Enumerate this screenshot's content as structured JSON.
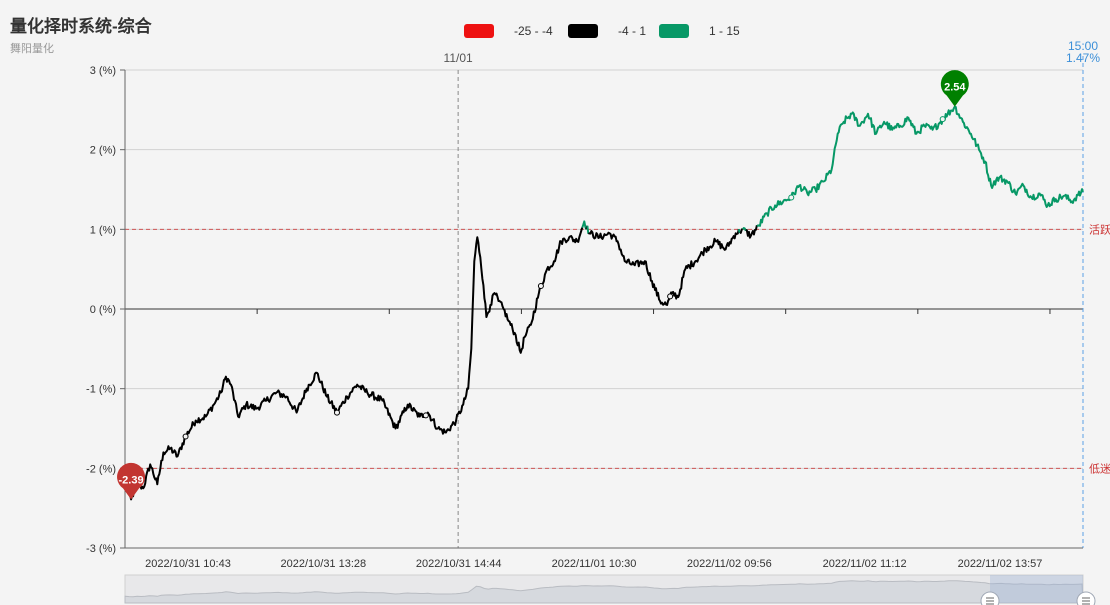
{
  "header": {
    "title": "量化择时系统-综合",
    "subtitle": "舞阳量化"
  },
  "legend": [
    {
      "label": "-25 - -4",
      "color": "#ee1111"
    },
    {
      "label": "-4 - 1",
      "color": "#000000"
    },
    {
      "label": "1 - 15",
      "color": "#079866"
    }
  ],
  "chart_data": {
    "type": "line",
    "y_tick_labels": [
      "3 (%)",
      "2 (%)",
      "1 (%)",
      "0 (%)",
      "-1 (%)",
      "-2 (%)",
      "-3 (%)"
    ],
    "x_tick_labels": [
      "2022/10/31 10:43",
      "2022/10/31 13:28",
      "2022/10/31 14:44",
      "2022/11/01 10:30",
      "2022/11/02 09:56",
      "2022/11/02 11:12",
      "2022/11/02 13:57"
    ],
    "ylim": [
      -3,
      3
    ],
    "grid": true,
    "legend_position": "top-center",
    "reference_lines": [
      {
        "value": 1,
        "label": "活跃"
      },
      {
        "value": -2,
        "label": "低迷"
      }
    ],
    "day_marker": {
      "index": 330,
      "label": "11/01"
    },
    "end_marker": {
      "time": "15:00",
      "value": "1.47%"
    },
    "max_point": {
      "index": 822,
      "value": 2.54,
      "label": "2.54"
    },
    "min_point": {
      "index": 6,
      "value": -2.39,
      "label": "-2.39"
    },
    "piece_colors": {
      "low": "#ee1111",
      "mid": "#000000",
      "high": "#079866"
    },
    "piece_thresholds": [
      -4,
      1,
      15
    ],
    "n_points": 950,
    "keyframes": [
      [
        0,
        -2.15
      ],
      [
        6,
        -2.39
      ],
      [
        12,
        -2.18
      ],
      [
        18,
        -2.25
      ],
      [
        25,
        -1.95
      ],
      [
        32,
        -2.2
      ],
      [
        38,
        -1.8
      ],
      [
        45,
        -1.75
      ],
      [
        52,
        -1.85
      ],
      [
        60,
        -1.6
      ],
      [
        70,
        -1.4
      ],
      [
        80,
        -1.35
      ],
      [
        88,
        -1.2
      ],
      [
        95,
        -1.05
      ],
      [
        100,
        -0.85
      ],
      [
        105,
        -0.95
      ],
      [
        112,
        -1.35
      ],
      [
        120,
        -1.2
      ],
      [
        130,
        -1.25
      ],
      [
        140,
        -1.15
      ],
      [
        150,
        -1.05
      ],
      [
        160,
        -1.1
      ],
      [
        170,
        -1.3
      ],
      [
        180,
        -1.0
      ],
      [
        190,
        -0.8
      ],
      [
        200,
        -1.1
      ],
      [
        210,
        -1.3
      ],
      [
        220,
        -1.1
      ],
      [
        230,
        -0.95
      ],
      [
        240,
        -1.05
      ],
      [
        255,
        -1.15
      ],
      [
        268,
        -1.5
      ],
      [
        280,
        -1.2
      ],
      [
        292,
        -1.35
      ],
      [
        300,
        -1.3
      ],
      [
        310,
        -1.5
      ],
      [
        318,
        -1.55
      ],
      [
        328,
        -1.4
      ],
      [
        335,
        -1.2
      ],
      [
        340,
        -1.0
      ],
      [
        343,
        -0.5
      ],
      [
        346,
        0.6
      ],
      [
        349,
        0.9
      ],
      [
        352,
        0.65
      ],
      [
        355,
        0.3
      ],
      [
        358,
        -0.1
      ],
      [
        362,
        0.05
      ],
      [
        366,
        0.2
      ],
      [
        370,
        0.1
      ],
      [
        375,
        0.0
      ],
      [
        380,
        -0.15
      ],
      [
        386,
        -0.3
      ],
      [
        392,
        -0.55
      ],
      [
        396,
        -0.35
      ],
      [
        402,
        -0.2
      ],
      [
        410,
        0.2
      ],
      [
        418,
        0.5
      ],
      [
        425,
        0.6
      ],
      [
        432,
        0.85
      ],
      [
        440,
        0.9
      ],
      [
        448,
        0.85
      ],
      [
        455,
        1.1
      ],
      [
        460,
        0.95
      ],
      [
        470,
        0.9
      ],
      [
        480,
        0.95
      ],
      [
        488,
        0.85
      ],
      [
        495,
        0.6
      ],
      [
        505,
        0.55
      ],
      [
        515,
        0.6
      ],
      [
        522,
        0.35
      ],
      [
        530,
        0.1
      ],
      [
        537,
        0.05
      ],
      [
        542,
        0.2
      ],
      [
        548,
        0.15
      ],
      [
        555,
        0.5
      ],
      [
        565,
        0.6
      ],
      [
        575,
        0.75
      ],
      [
        585,
        0.85
      ],
      [
        595,
        0.75
      ],
      [
        605,
        0.95
      ],
      [
        612,
        1.0
      ],
      [
        620,
        0.92
      ],
      [
        628,
        1.05
      ],
      [
        636,
        1.2
      ],
      [
        644,
        1.3
      ],
      [
        652,
        1.35
      ],
      [
        660,
        1.4
      ],
      [
        668,
        1.55
      ],
      [
        676,
        1.45
      ],
      [
        684,
        1.5
      ],
      [
        692,
        1.6
      ],
      [
        700,
        1.75
      ],
      [
        706,
        2.2
      ],
      [
        712,
        2.35
      ],
      [
        720,
        2.45
      ],
      [
        728,
        2.3
      ],
      [
        736,
        2.45
      ],
      [
        744,
        2.2
      ],
      [
        752,
        2.35
      ],
      [
        760,
        2.25
      ],
      [
        768,
        2.3
      ],
      [
        776,
        2.4
      ],
      [
        784,
        2.2
      ],
      [
        792,
        2.3
      ],
      [
        800,
        2.25
      ],
      [
        808,
        2.35
      ],
      [
        815,
        2.45
      ],
      [
        822,
        2.54
      ],
      [
        830,
        2.35
      ],
      [
        838,
        2.2
      ],
      [
        846,
        2.0
      ],
      [
        852,
        1.85
      ],
      [
        858,
        1.55
      ],
      [
        866,
        1.65
      ],
      [
        874,
        1.6
      ],
      [
        882,
        1.45
      ],
      [
        890,
        1.55
      ],
      [
        898,
        1.4
      ],
      [
        906,
        1.45
      ],
      [
        914,
        1.3
      ],
      [
        922,
        1.38
      ],
      [
        930,
        1.42
      ],
      [
        938,
        1.35
      ],
      [
        944,
        1.43
      ],
      [
        949,
        1.47
      ]
    ]
  }
}
